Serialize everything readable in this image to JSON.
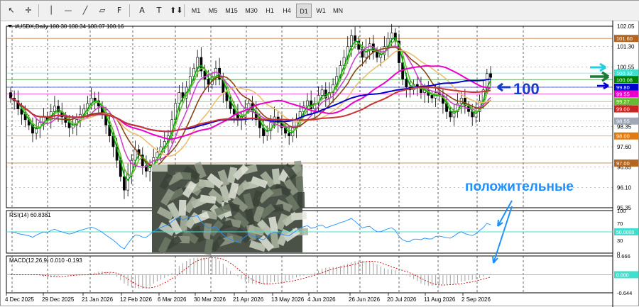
{
  "toolbar": {
    "tools": [
      {
        "name": "cursor-icon",
        "glyph": "↖"
      },
      {
        "name": "crosshair-icon",
        "glyph": "✛"
      },
      {
        "name": "vertical-line-icon",
        "glyph": "│"
      },
      {
        "name": "horizontal-line-icon",
        "glyph": "—"
      },
      {
        "name": "trendline-icon",
        "glyph": "╱"
      },
      {
        "name": "equidistant-channel-icon",
        "glyph": "▱"
      },
      {
        "name": "fibonacci-icon",
        "glyph": "F"
      },
      {
        "name": "text-tool-icon",
        "glyph": "A"
      },
      {
        "name": "text-label-icon",
        "glyph": "T"
      },
      {
        "name": "arrows-icon",
        "glyph": "⬆⬇"
      }
    ],
    "timeframes": [
      "M1",
      "M5",
      "M15",
      "M30",
      "H1",
      "H4",
      "D1",
      "W1",
      "MN"
    ],
    "active_timeframe": "D1"
  },
  "chart_data": {
    "type": "candlestick",
    "symbol_info": "#USDX,Daily  100.30 100.34 100.07 100.16",
    "price_axis": {
      "range": [
        95.35,
        102.05
      ],
      "ticks": [
        "102.05",
        "101.30",
        "100.55",
        "99.80",
        "99.10",
        "98.35",
        "97.60",
        "96.85",
        "96.10",
        "95.35"
      ]
    },
    "x_labels": [
      "4 Dec 2025",
      "29 Dec 2025",
      "21 Jan 2026",
      "12 Feb 2026",
      "6 Mar 2026",
      "30 Mar 2026",
      "21 Apr 2026",
      "13 May 2026",
      "4 Jun 2026",
      "26 Jun 2026",
      "20 Jul 2026",
      "11 Aug 2026",
      "2 Sep 2026"
    ],
    "closes": [
      99.4,
      99.3,
      99.0,
      98.8,
      98.6,
      98.4,
      98.1,
      98.3,
      98.5,
      98.7,
      98.6,
      98.9,
      99.1,
      98.9,
      98.7,
      98.5,
      98.3,
      98.4,
      98.6,
      98.8,
      99.0,
      99.2,
      99.4,
      99.3,
      99.1,
      98.8,
      98.4,
      98.0,
      97.6,
      97.1,
      96.5,
      96.0,
      96.6,
      97.1,
      97.5,
      97.3,
      96.9,
      96.7,
      96.9,
      97.2,
      97.4,
      97.6,
      97.8,
      98.0,
      98.6,
      99.2,
      99.6,
      99.4,
      99.8,
      100.2,
      100.5,
      100.9,
      100.4,
      100.1,
      99.9,
      100.2,
      100.5,
      100.1,
      99.6,
      99.3,
      99.0,
      98.8,
      98.6,
      98.7,
      99.0,
      99.2,
      98.9,
      98.6,
      98.3,
      98.0,
      98.2,
      98.5,
      98.7,
      98.5,
      98.3,
      98.1,
      98.0,
      98.3,
      98.6,
      98.9,
      99.1,
      99.3,
      99.0,
      99.2,
      99.5,
      99.7,
      99.4,
      99.6,
      99.9,
      100.2,
      100.6,
      100.9,
      101.3,
      101.7,
      101.5,
      101.2,
      100.9,
      101.2,
      101.4,
      101.1,
      100.9,
      101.0,
      101.3,
      101.6,
      101.8,
      101.5,
      100.7,
      100.1,
      99.8,
      99.7,
      99.9,
      99.8,
      99.6,
      99.7,
      99.5,
      99.4,
      99.6,
      99.5,
      99.2,
      98.9,
      98.7,
      98.9,
      99.2,
      99.4,
      99.1,
      98.9,
      98.7,
      98.9,
      99.3,
      99.7,
      100.3,
      100.16
    ],
    "overlay_series": [
      {
        "color": "#00aa00",
        "period": 8
      },
      {
        "color": "#66bb33",
        "period": 13
      },
      {
        "color": "#cc44cc",
        "period": 21
      },
      {
        "color": "#8b4513",
        "period": 34
      },
      {
        "color": "#e8c070",
        "period": 55
      },
      {
        "color": "#ee00cc",
        "period": 89
      },
      {
        "color": "#0000cc",
        "period": 144
      },
      {
        "color": "#cc3333",
        "period": 200
      }
    ],
    "price_labels": [
      {
        "value": 101.6,
        "text": "101.60",
        "color": "#b5651d",
        "line_color": "#b5651d"
      },
      {
        "value": 100.32,
        "text": "100.32",
        "color": "#40e0d0",
        "line_color": "#40e0d0"
      },
      {
        "value": 100.08,
        "text": "100.08",
        "color": "#008000",
        "line_color": "#008000"
      },
      {
        "value": 99.8,
        "text": "99.80",
        "color": "#0000cc",
        "line_color": "#0000cc"
      },
      {
        "value": 99.55,
        "text": "99.55",
        "color": "#ee00cc",
        "line_color": "#ee00cc"
      },
      {
        "value": 99.27,
        "text": "99.27",
        "color": "#66bb33",
        "line_color": "#66bb33"
      },
      {
        "value": 99.0,
        "text": "99.00",
        "color": "#cc2222",
        "line_color": "#cc2222"
      },
      {
        "value": 98.55,
        "text": "98.55",
        "color": "#a0a8b8",
        "line_color": "#a0a8b8"
      },
      {
        "value": 98.0,
        "text": "98.00",
        "color": "#e07b10",
        "line_color": "#e07b10"
      },
      {
        "value": 97.0,
        "text": "97.00",
        "color": "#b5651d",
        "line_color": "#b5651d"
      }
    ],
    "annotations": [
      {
        "text": "100",
        "color": "#1a3cc8"
      },
      {
        "text": "положительные",
        "color": "#1e90ff"
      }
    ],
    "rsi": {
      "label": "RSI(14) 60.8381",
      "ticks": [
        "100",
        "70",
        "50.0000",
        "30",
        "0"
      ],
      "level_label": "50.0000"
    },
    "macd": {
      "label": "MACD(12,26,9) 0.010 -0.193",
      "ticks": [
        "0.666",
        "0.000",
        "-0.644"
      ],
      "range": [
        -0.644,
        0.666
      ]
    }
  },
  "colors": {
    "up_candle": "#ffffff",
    "down_candle": "#000000",
    "rsi_line": "#1e90ff",
    "macd_hist": "#a0a0a0",
    "macd_signal": "#cc0000",
    "grid": "#000000"
  }
}
